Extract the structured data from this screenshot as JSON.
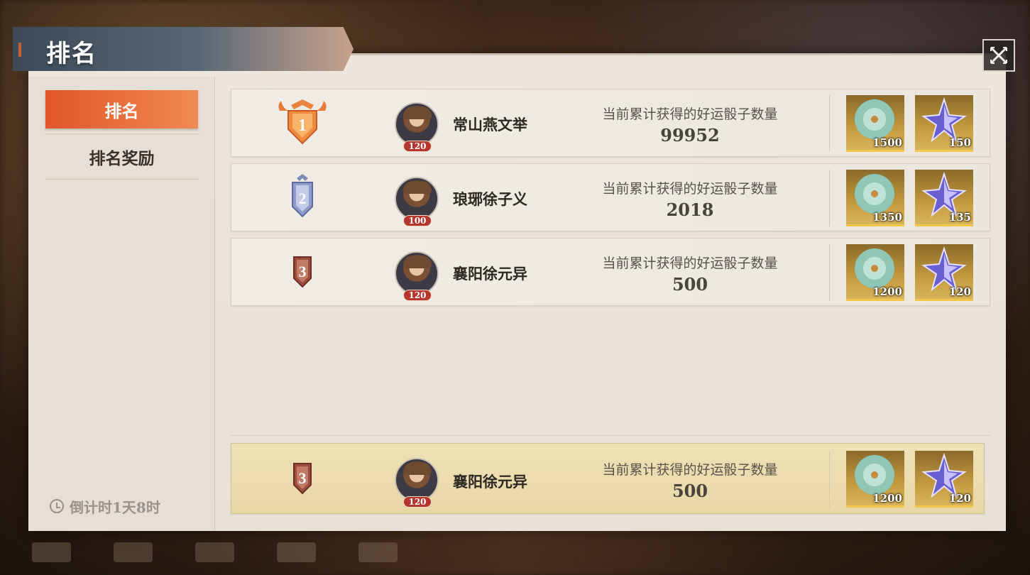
{
  "window": {
    "title": "排名",
    "close_icon": "close-icon"
  },
  "sidebar": {
    "items": [
      {
        "label": "排名",
        "active": true
      },
      {
        "label": "排名奖励",
        "active": false
      }
    ],
    "countdown": "倒计时1天8时"
  },
  "colors": {
    "accent": "#e96a3c",
    "self_row": "#ecdcae",
    "level_badge": "#b5362e",
    "reward_border": "#f2c64a"
  },
  "rankings": [
    {
      "rank": "1",
      "name": "常山燕文举",
      "level": "120",
      "stat_label": "当前累计获得的好运骰子数量",
      "stat_value": "99952",
      "rewards": [
        {
          "icon": "jade-disc-icon",
          "count": "1500"
        },
        {
          "icon": "purple-star-icon",
          "count": "150"
        }
      ]
    },
    {
      "rank": "2",
      "name": "琅琊徐子义",
      "level": "100",
      "stat_label": "当前累计获得的好运骰子数量",
      "stat_value": "2018",
      "rewards": [
        {
          "icon": "jade-disc-icon",
          "count": "1350"
        },
        {
          "icon": "purple-star-icon",
          "count": "135"
        }
      ]
    },
    {
      "rank": "3",
      "name": "襄阳徐元异",
      "level": "120",
      "stat_label": "当前累计获得的好运骰子数量",
      "stat_value": "500",
      "rewards": [
        {
          "icon": "jade-disc-icon",
          "count": "1200"
        },
        {
          "icon": "purple-star-icon",
          "count": "120"
        }
      ]
    }
  ],
  "self_rank": {
    "rank": "3",
    "name": "襄阳徐元异",
    "level": "120",
    "stat_label": "当前累计获得的好运骰子数量",
    "stat_value": "500",
    "rewards": [
      {
        "icon": "jade-disc-icon",
        "count": "1200"
      },
      {
        "icon": "purple-star-icon",
        "count": "120"
      }
    ]
  }
}
